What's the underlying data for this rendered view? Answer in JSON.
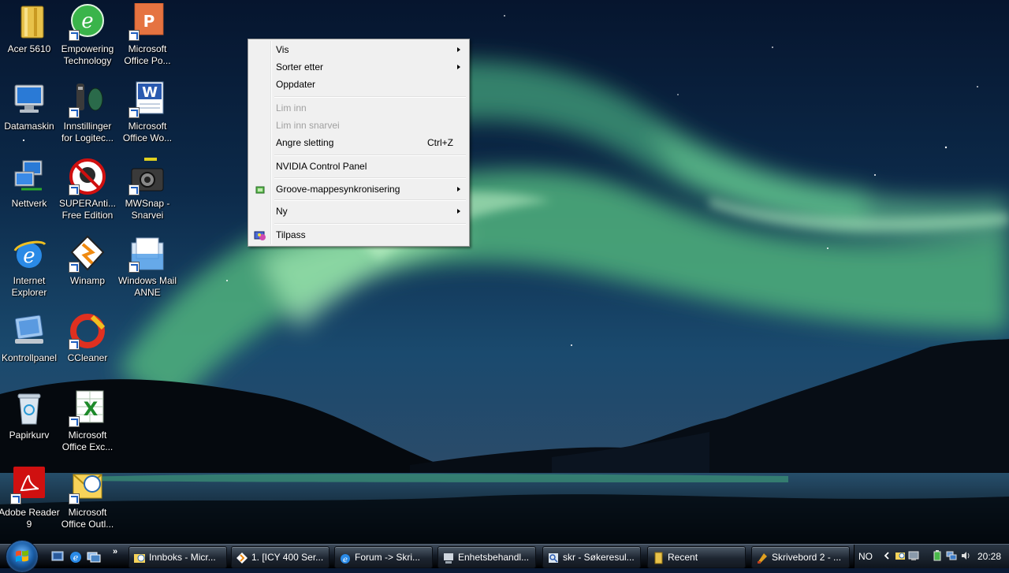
{
  "desktop": {
    "icons": [
      {
        "label": "Acer 5610",
        "icon": "folder-icon"
      },
      {
        "label": "Empowering Technology",
        "icon": "empowering-technology-icon"
      },
      {
        "label": "Microsoft Office Po...",
        "icon": "powerpoint-icon"
      },
      {
        "label": "Datamaskin",
        "icon": "computer-icon"
      },
      {
        "label": "Innstillinger for Logitec...",
        "icon": "logitech-settings-icon"
      },
      {
        "label": "Microsoft Office Wo...",
        "icon": "word-icon"
      },
      {
        "label": "Nettverk",
        "icon": "network-icon"
      },
      {
        "label": "SUPERAnti... Free Edition",
        "icon": "superantispyware-icon"
      },
      {
        "label": "MWSnap - Snarvei",
        "icon": "camera-icon"
      },
      {
        "label": "Internet Explorer",
        "icon": "internet-explorer-icon"
      },
      {
        "label": "Winamp",
        "icon": "winamp-icon"
      },
      {
        "label": "Windows Mail ANNE",
        "icon": "windows-mail-icon"
      },
      {
        "label": "Kontrollpanel",
        "icon": "control-panel-icon"
      },
      {
        "label": "CCleaner",
        "icon": "ccleaner-icon"
      },
      {
        "label": "Papirkurv",
        "icon": "recycle-bin-icon"
      },
      {
        "label": "Microsoft Office Exc...",
        "icon": "excel-icon"
      },
      {
        "label": "Adobe Reader 9",
        "icon": "adobe-reader-icon"
      },
      {
        "label": "Microsoft Office Outl...",
        "icon": "outlook-icon"
      }
    ]
  },
  "context_menu": {
    "items": [
      {
        "label": "Vis",
        "submenu": true,
        "enabled": true
      },
      {
        "label": "Sorter etter",
        "submenu": true,
        "enabled": true
      },
      {
        "label": "Oppdater",
        "enabled": true
      },
      {
        "label": "Lim inn",
        "enabled": false
      },
      {
        "label": "Lim inn snarvei",
        "enabled": false
      },
      {
        "label": "Angre sletting",
        "shortcut": "Ctrl+Z",
        "enabled": true
      },
      {
        "label": "NVIDIA Control Panel",
        "enabled": true
      },
      {
        "label": "Groove-mappesynkronisering",
        "submenu": true,
        "enabled": true,
        "icon": "groove-icon"
      },
      {
        "label": "Ny",
        "submenu": true,
        "enabled": true
      },
      {
        "label": "Tilpass",
        "enabled": true,
        "icon": "personalize-icon"
      }
    ]
  },
  "taskbar": {
    "start": {
      "icon": "windows-start-icon"
    },
    "quick_launch": [
      {
        "icon": "show-desktop-icon"
      },
      {
        "icon": "internet-explorer-icon"
      },
      {
        "icon": "switch-windows-icon"
      }
    ],
    "quick_launch_more": "»",
    "buttons": [
      {
        "label": "Innboks - Micr...",
        "icon": "outlook-icon"
      },
      {
        "label": "1. [ICY 400 Ser...",
        "icon": "winamp-icon"
      },
      {
        "label": "Forum -> Skri...",
        "icon": "internet-explorer-icon"
      },
      {
        "label": "Enhetsbehandl...",
        "icon": "device-manager-icon"
      },
      {
        "label": "skr - Søkeresul...",
        "icon": "search-icon"
      },
      {
        "label": "Recent",
        "icon": "folder-icon"
      },
      {
        "label": "Skrivebord 2 - ...",
        "icon": "mwsnap-icon"
      }
    ],
    "tray": {
      "language": "NO",
      "clock": "20:28",
      "icons": [
        "chevron-left-icon",
        "outlook-tray-icon",
        "display-tray-icon",
        "power-icon",
        "network-tray-icon",
        "volume-icon"
      ]
    }
  },
  "colors": {
    "menu_background": "#f0f0f0",
    "menu_disabled_text": "#a0a0a0",
    "taskbar": "#151d28"
  }
}
